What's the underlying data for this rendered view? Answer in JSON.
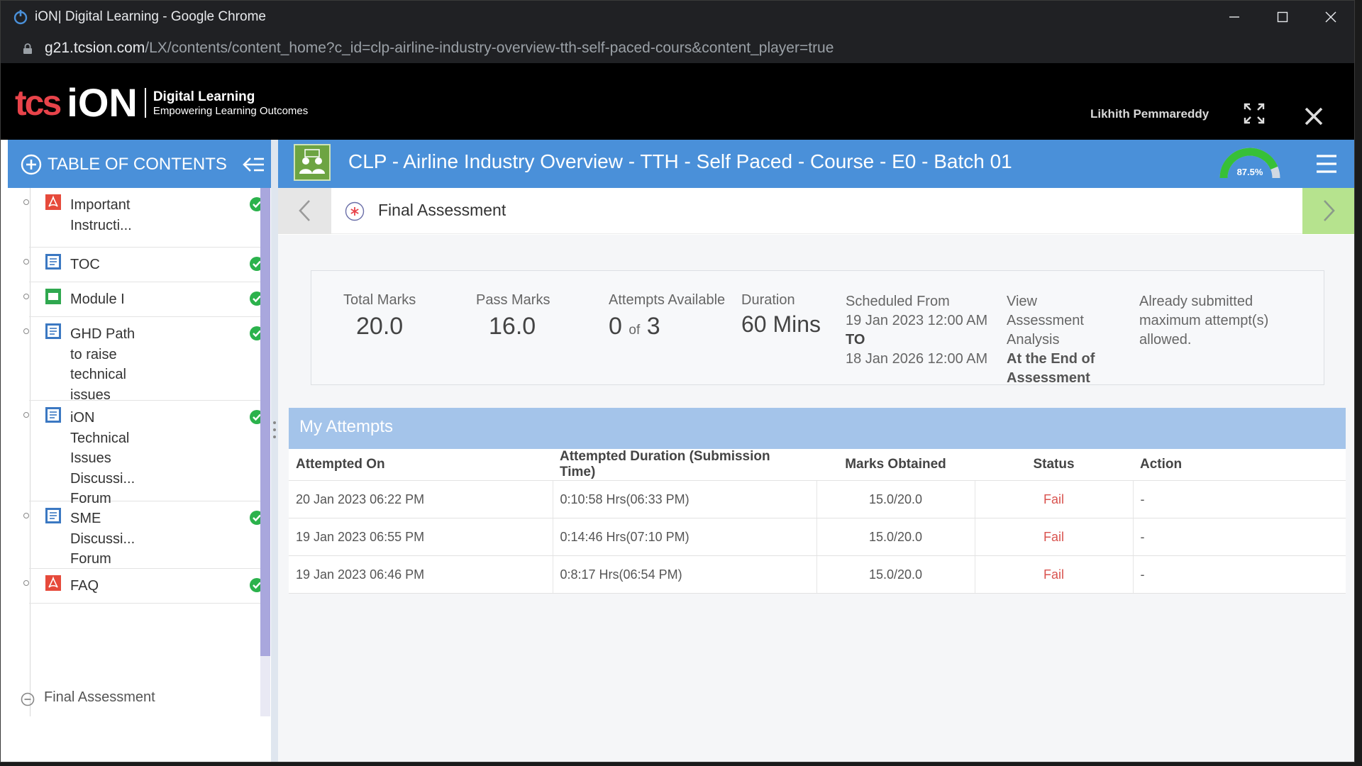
{
  "browser": {
    "title": "iON| Digital Learning - Google Chrome",
    "url_host": "g21.tcsion.com",
    "url_path": "/LX/contents/content_home?c_id=clp-airline-industry-overview-tth-self-paced-cours&content_player=true"
  },
  "header": {
    "logo_tcs": "tcs",
    "logo_ion": "iON",
    "logo_line1": "Digital Learning",
    "logo_line2": "Empowering Learning Outcomes",
    "username": "Likhith Pemmareddy"
  },
  "sidebar": {
    "title": "TABLE OF CONTENTS",
    "items": [
      {
        "label": "Important Instructi...",
        "type": "pdf"
      },
      {
        "label": "TOC",
        "type": "doc"
      },
      {
        "label": "Module I",
        "type": "video"
      },
      {
        "label": "GHD Path to raise technical issues",
        "type": "doc"
      },
      {
        "label": "iON Technical Issues Discussi... Forum",
        "type": "doc"
      },
      {
        "label": "SME Discussi... Forum",
        "type": "doc"
      },
      {
        "label": "FAQ",
        "type": "pdf"
      }
    ],
    "final_item": "Final Assessment"
  },
  "course": {
    "title": "CLP - Airline Industry Overview - TTH - Self Paced - Course - E0 - Batch 01",
    "progress_label": "87.5%",
    "progress": 0.875
  },
  "section": {
    "title": "Final Assessment"
  },
  "summary": {
    "total_marks_label": "Total Marks",
    "total_marks": "20.0",
    "pass_marks_label": "Pass Marks",
    "pass_marks": "16.0",
    "attempts_label": "Attempts Available",
    "attempts_used": "0",
    "attempts_of": "of",
    "attempts_total": "3",
    "duration_label": "Duration",
    "duration": "60 Mins",
    "scheduled_label": "Scheduled From",
    "scheduled_from": "19 Jan 2023 12:00 AM",
    "scheduled_to_label": "TO",
    "scheduled_to": "18 Jan 2026 12:00 AM",
    "analysis_label": "View Assessment Analysis",
    "analysis_value": "At the End of Assessment",
    "submitted_note": "Already submitted maximum attempt(s) allowed."
  },
  "attempts": {
    "title": "My Attempts",
    "columns": [
      "Attempted On",
      "Attempted Duration (Submission Time)",
      "Marks Obtained",
      "Status",
      "Action"
    ],
    "rows": [
      {
        "date": "20 Jan 2023 06:22 PM",
        "duration": "0:10:58 Hrs(06:33 PM)",
        "marks": "15.0/20.0",
        "status": "Fail",
        "action": "-"
      },
      {
        "date": "19 Jan 2023 06:55 PM",
        "duration": "0:14:46 Hrs(07:10 PM)",
        "marks": "15.0/20.0",
        "status": "Fail",
        "action": "-"
      },
      {
        "date": "19 Jan 2023 06:46 PM",
        "duration": "0:8:17 Hrs(06:54 PM)",
        "marks": "15.0/20.0",
        "status": "Fail",
        "action": "-"
      }
    ]
  },
  "colors": {
    "primary": "#4a90d9",
    "attempts_header": "#a4c4ea",
    "next_button": "#b6e38e",
    "success_check": "#2bb24c",
    "fail_text": "#d9534f"
  }
}
